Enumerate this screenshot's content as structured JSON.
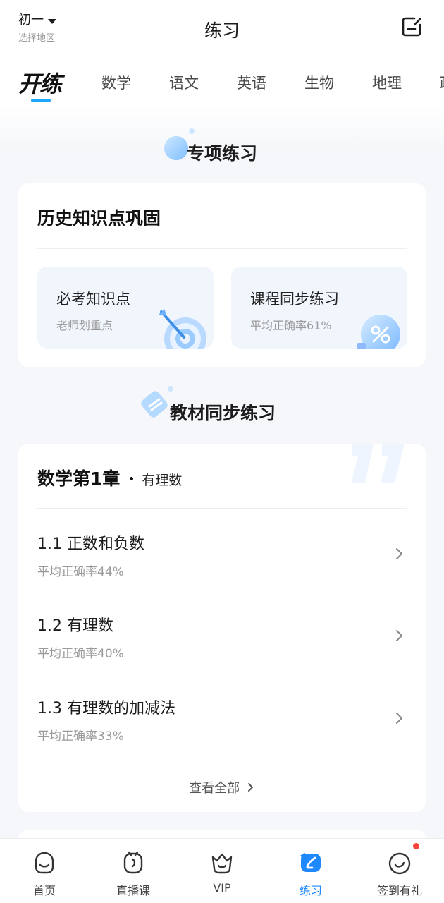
{
  "header": {
    "region_grade": "初一",
    "region_hint": "选择地区",
    "title": "练习"
  },
  "subject_tabs": {
    "brand": "开练",
    "items": [
      "数学",
      "语文",
      "英语",
      "生物",
      "地理",
      "政"
    ]
  },
  "special_practice": {
    "section_title": "专项练习",
    "card_title": "历史知识点巩固",
    "items": [
      {
        "title": "必考知识点",
        "subtitle": "老师划重点"
      },
      {
        "title": "课程同步练习",
        "subtitle": "平均正确率61%"
      }
    ]
  },
  "textbook_practice": {
    "section_title": "教材同步练习",
    "chapter_main": "数学第1章",
    "chapter_sub": "有理数",
    "lessons": [
      {
        "title": "1.1 正数和负数",
        "accuracy": "平均正确率44%"
      },
      {
        "title": "1.2 有理数",
        "accuracy": "平均正确率40%"
      },
      {
        "title": "1.3 有理数的加减法",
        "accuracy": "平均正确率33%"
      }
    ],
    "view_all": "查看全部"
  },
  "bottom_nav": {
    "items": [
      {
        "label": "首页",
        "icon": "home-face-icon"
      },
      {
        "label": "直播课",
        "icon": "live-class-icon"
      },
      {
        "label": "VIP",
        "icon": "vip-crown-icon"
      },
      {
        "label": "练习",
        "icon": "practice-pen-icon"
      },
      {
        "label": "签到有礼",
        "icon": "checkin-gift-icon"
      }
    ],
    "active_index": 3
  },
  "colors": {
    "accent": "#1e88ff",
    "background": "#f5f7fa",
    "card": "#ffffff",
    "mini_card": "#f1f6fd",
    "badge_red": "#f5443a"
  }
}
